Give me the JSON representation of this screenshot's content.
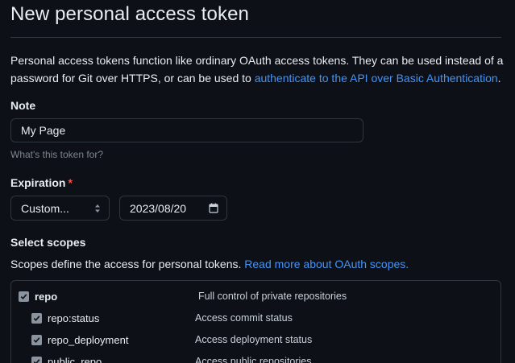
{
  "page": {
    "title": "New personal access token",
    "intro_text": "Personal access tokens function like ordinary OAuth access tokens. They can be used instead of a password for Git over HTTPS, or can be used to ",
    "intro_link": "authenticate to the API over Basic Authentication",
    "intro_end": "."
  },
  "note": {
    "label": "Note",
    "value": "My Page",
    "hint": "What's this token for?"
  },
  "expiration": {
    "label": "Expiration",
    "required_mark": "*",
    "selected": "Custom...",
    "date_value": "2023/08/20"
  },
  "scopes": {
    "heading": "Select scopes",
    "description": "Scopes define the access for personal tokens. ",
    "link": "Read more about OAuth scopes.",
    "items": [
      {
        "name": "repo",
        "description": "Full control of private repositories",
        "checked": true
      },
      {
        "name": "repo:status",
        "description": "Access commit status",
        "checked": true
      },
      {
        "name": "repo_deployment",
        "description": "Access deployment status",
        "checked": true
      },
      {
        "name": "public_repo",
        "description": "Access public repositories",
        "checked": true
      }
    ]
  },
  "colors": {
    "background": "#0d1117",
    "border": "#30363d",
    "link": "#4493f8",
    "required": "#f85149",
    "muted": "#7d8590"
  }
}
